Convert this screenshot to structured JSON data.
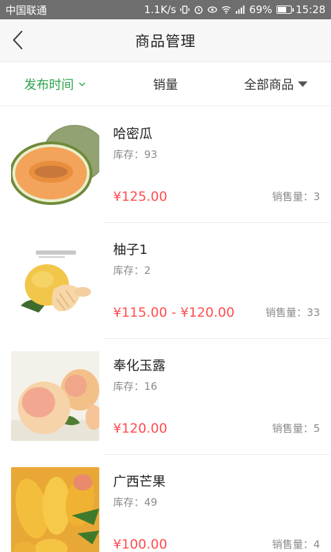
{
  "status_bar": {
    "carrier": "中国联通",
    "speed": "1.1K/s",
    "battery": "69%",
    "battery_level": 0.69,
    "time": "15:28"
  },
  "header": {
    "title": "商品管理"
  },
  "filters": [
    {
      "label": "发布时间",
      "active": true
    },
    {
      "label": "销量",
      "active": false
    },
    {
      "label": "全部商品",
      "active": false
    }
  ],
  "products": [
    {
      "name": "哈密瓜",
      "stock": "库存：93",
      "price": "¥125.00",
      "sales": "销售量：3",
      "image": "melon"
    },
    {
      "name": "柚子1",
      "stock": "库存：2",
      "price": "¥115.00 - ¥120.00",
      "sales": "销售量：33",
      "image": "pomelo"
    },
    {
      "name": "奉化玉露",
      "stock": "库存：16",
      "price": "¥120.00",
      "sales": "销售量：5",
      "image": "peach"
    },
    {
      "name": "广西芒果",
      "stock": "库存：49",
      "price": "¥100.00",
      "sales": "销售量：4",
      "image": "mango"
    }
  ],
  "colors": {
    "accent": "#2aa24a",
    "price": "#ff4d4f"
  }
}
